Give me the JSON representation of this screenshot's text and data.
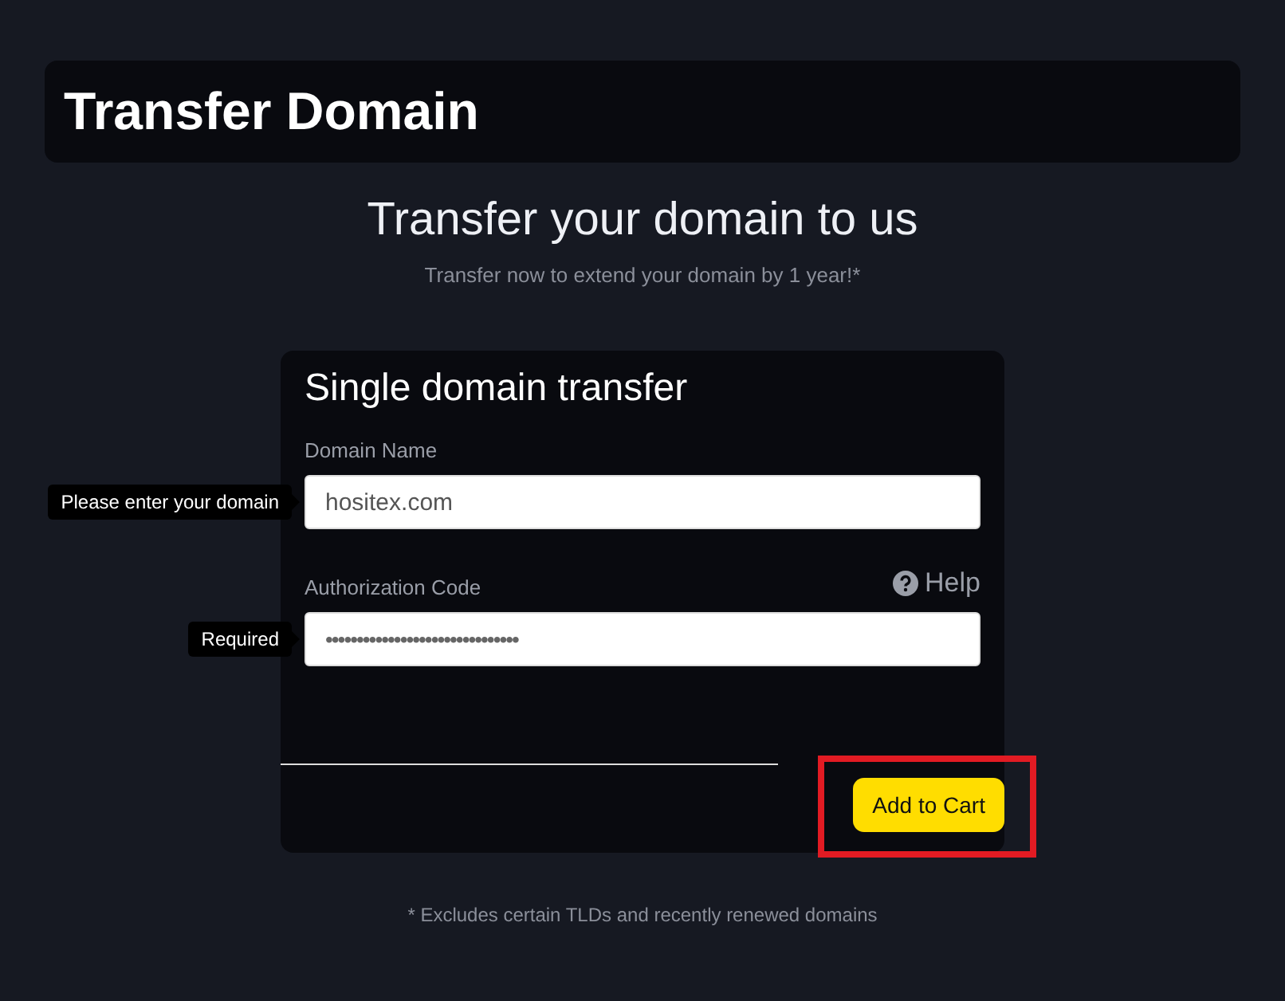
{
  "header": {
    "title": "Transfer Domain"
  },
  "intro": {
    "heading": "Transfer your domain to us",
    "subtitle": "Transfer now to extend your domain by 1 year!*"
  },
  "form": {
    "title": "Single domain transfer",
    "fields": [
      {
        "label": "Domain Name",
        "value": "hositex.com",
        "tooltip": "Please enter your domain",
        "masked": false
      },
      {
        "label": "Authorization Code",
        "value": "•••••••••••••••••••••••••••••••",
        "tooltip": "Required",
        "masked": true,
        "help": "Help"
      }
    ],
    "submit": {
      "label": "Add to Cart",
      "highlighted": true
    }
  },
  "footnote": "* Excludes certain TLDs and recently renewed domains"
}
